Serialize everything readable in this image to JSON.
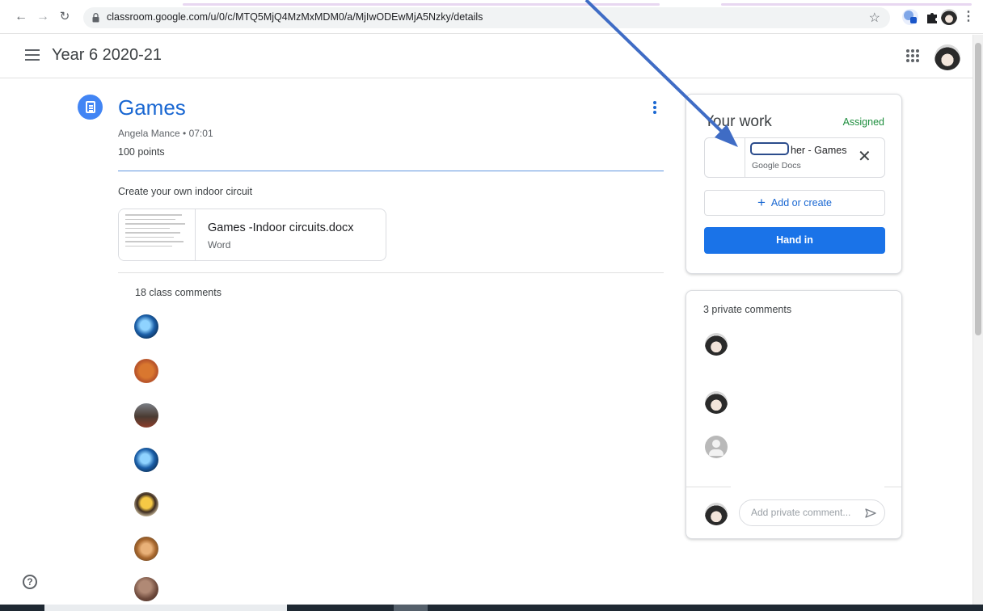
{
  "browser": {
    "url": "classroom.google.com/u/0/c/MTQ5MjQ4MzMxMDM0/a/MjIwODEwMjA5Nzky/details"
  },
  "header": {
    "class_name": "Year 6 2020-21"
  },
  "assignment": {
    "title": "Games",
    "meta": "Angela Mance • 07:01",
    "points": "100 points",
    "instructions": "Create your own indoor circuit",
    "attachment": {
      "name": "Games -Indoor circuits.docx",
      "type": "Word"
    },
    "class_comments_label": "18 class comments"
  },
  "your_work": {
    "title": "Your work",
    "status": "Assigned",
    "file": {
      "name": "her - Games",
      "type": "Google Docs"
    },
    "add_or_create": "Add or create",
    "hand_in": "Hand in"
  },
  "private_comments": {
    "label": "3 private comments",
    "placeholder": "Add private comment..."
  },
  "colors": {
    "accent": "#1a73e8",
    "title_blue": "#1967d2",
    "assigned_green": "#1e8e3e",
    "annotation_arrow": "#3f6cc5"
  },
  "icons": [
    "back-arrow-icon",
    "forward-arrow-icon",
    "reload-icon",
    "lock-icon",
    "star-icon",
    "extension-icon",
    "puzzle-icon",
    "hamburger-menu-icon",
    "apps-grid-icon",
    "assignment-icon",
    "more-vert-icon",
    "close-icon",
    "plus-icon",
    "send-icon",
    "help-icon"
  ]
}
